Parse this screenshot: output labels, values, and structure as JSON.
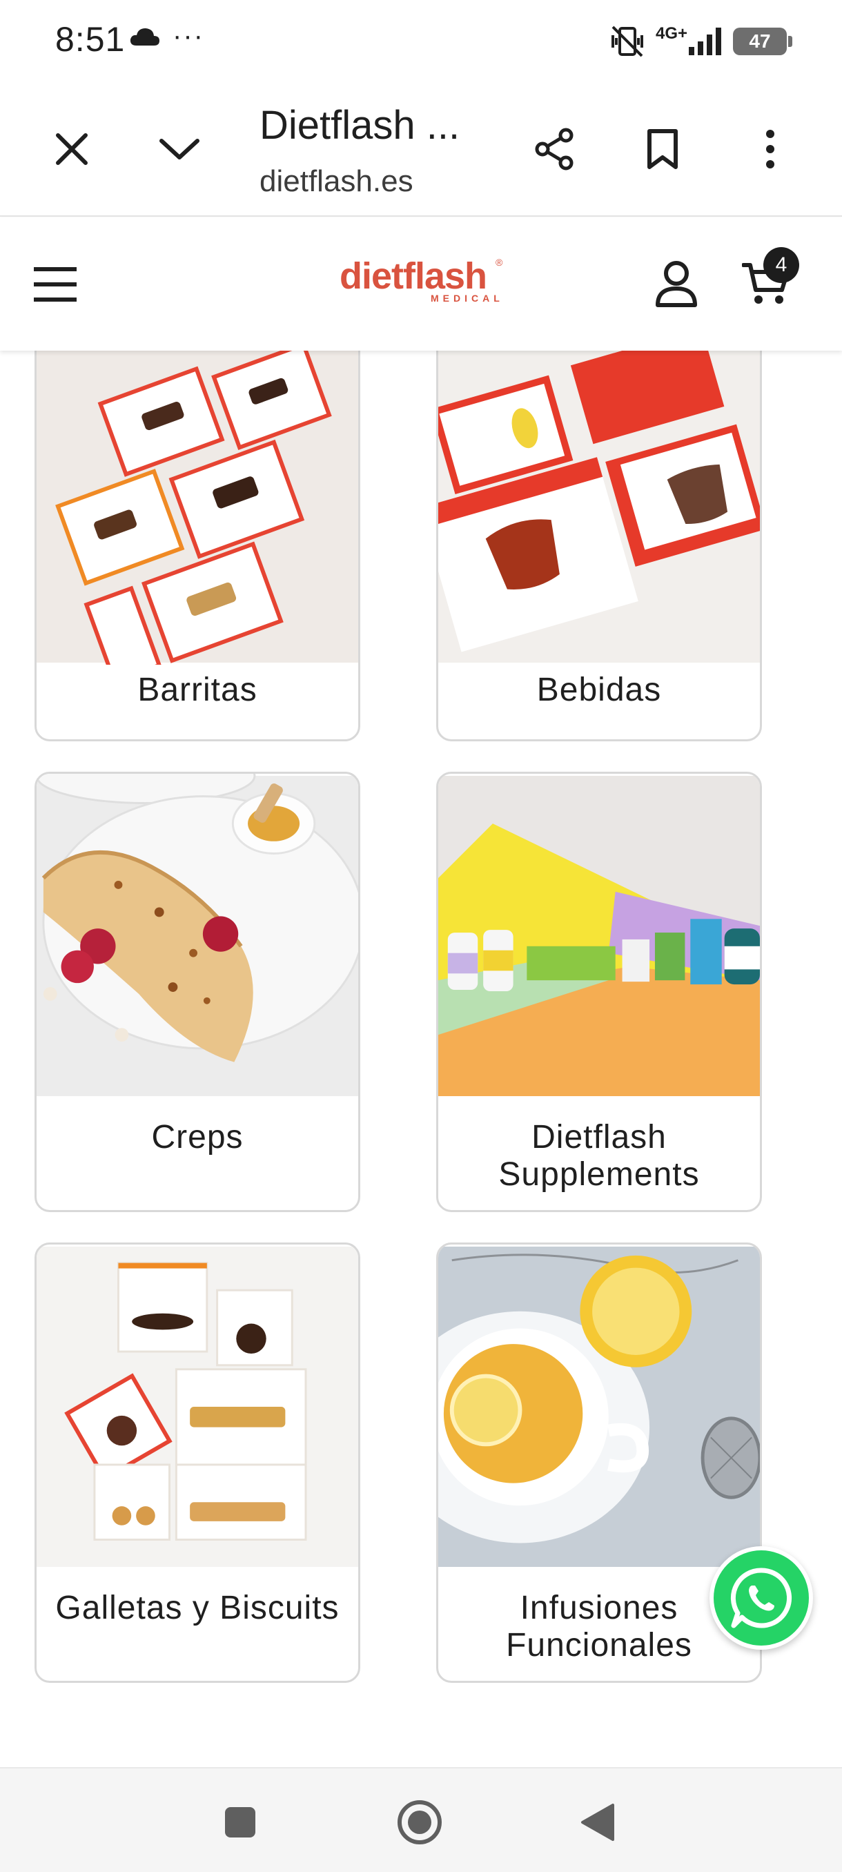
{
  "status_bar": {
    "time": "8:51",
    "dots": "···",
    "network": "4G+",
    "battery": "47"
  },
  "toolbar": {
    "title": "Dietflash ...",
    "url": "dietflash.es"
  },
  "site_header": {
    "logo_text": "dietflash",
    "logo_subtext": "MEDICAL",
    "logo_reg": "®",
    "cart_count": "4"
  },
  "categories": [
    {
      "label": "Barritas",
      "icon": "protein-bar-boxes-image"
    },
    {
      "label": "Bebidas",
      "icon": "drink-boxes-image"
    },
    {
      "label": "Creps",
      "icon": "crepe-plate-image"
    },
    {
      "label": "Dietflash Supplements",
      "icon": "supplement-bottles-image"
    },
    {
      "label": "Galletas y Biscuits",
      "icon": "cookie-boxes-image"
    },
    {
      "label": "Infusiones Funcionales",
      "icon": "tea-cup-lemon-image"
    }
  ],
  "colors": {
    "brand": "#d9533f",
    "whatsapp": "#25d366",
    "card_border": "#d8d8d8"
  }
}
